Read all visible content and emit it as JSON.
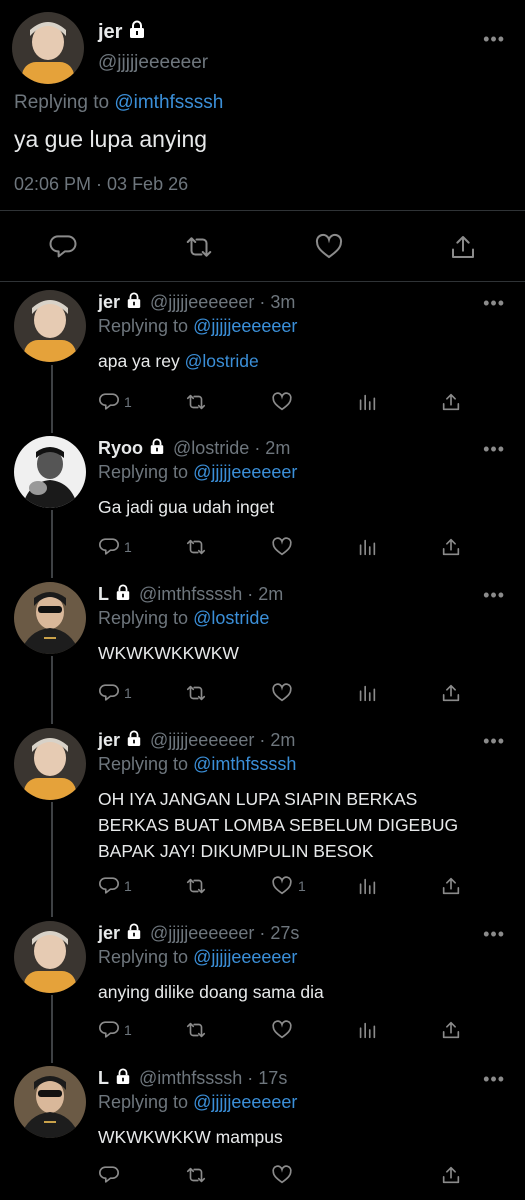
{
  "main_tweet": {
    "name": "jer",
    "handle": "@jjjjjeeeeeer",
    "replying_prefix": "Replying to ",
    "replying_to": "@imthfssssh",
    "text": "ya gue lupa anying",
    "timestamp": "02:06 PM · 03 Feb 26",
    "more": "•••"
  },
  "replies": [
    {
      "name": "jer",
      "handle": "@jjjjjeeeeeer",
      "time": "· 3m",
      "replying_prefix": "Replying to ",
      "replying_to": "@jjjjjeeeeeer",
      "text_plain": "apa ya rey ",
      "text_mention": "@lostride",
      "reply_count": "1",
      "like_count": ""
    },
    {
      "name": "Ryoo",
      "handle": "@lostride",
      "time": "· 2m",
      "replying_prefix": "Replying to ",
      "replying_to": "@jjjjjeeeeeer",
      "text_plain": "Ga jadi gua udah inget",
      "text_mention": "",
      "reply_count": "1",
      "like_count": ""
    },
    {
      "name": "L",
      "handle": "@imthfssssh",
      "time": "· 2m",
      "replying_prefix": "Replying to ",
      "replying_to": "@lostride",
      "text_plain": "WKWKWKKWKW",
      "text_mention": "",
      "reply_count": "1",
      "like_count": ""
    },
    {
      "name": "jer",
      "handle": "@jjjjjeeeeeer",
      "time": "· 2m",
      "replying_prefix": "Replying to ",
      "replying_to": "@imthfssssh",
      "text_plain": "OH IYA JANGAN LUPA SIAPIN BERKAS BERKAS BUAT LOMBA SEBELUM DIGEBUG BAPAK JAY! DIKUMPULIN BESOK",
      "text_mention": "",
      "reply_count": "1",
      "like_count": "1"
    },
    {
      "name": "jer",
      "handle": "@jjjjjeeeeeer",
      "time": "· 27s",
      "replying_prefix": "Replying to ",
      "replying_to": "@jjjjjeeeeeer",
      "text_plain": "anying dilike doang sama dia",
      "text_mention": "",
      "reply_count": "1",
      "like_count": ""
    },
    {
      "name": "L",
      "handle": "@imthfssssh",
      "time": "· 17s",
      "replying_prefix": "Replying to ",
      "replying_to": "@jjjjjeeeeeer",
      "text_plain": "WKWKWKKW mampus",
      "text_mention": "",
      "reply_count": "",
      "like_count": ""
    }
  ],
  "icons": {
    "reply": "reply-icon",
    "retweet": "retweet-icon",
    "like": "heart-icon",
    "analytics": "analytics-icon",
    "share": "share-icon",
    "lock": "lock-icon",
    "more": "more-icon"
  },
  "colors": {
    "background": "#000000",
    "text": "#e7e9ea",
    "muted": "#6e767d",
    "link": "#3b8fd8",
    "divider": "#2f3336"
  }
}
